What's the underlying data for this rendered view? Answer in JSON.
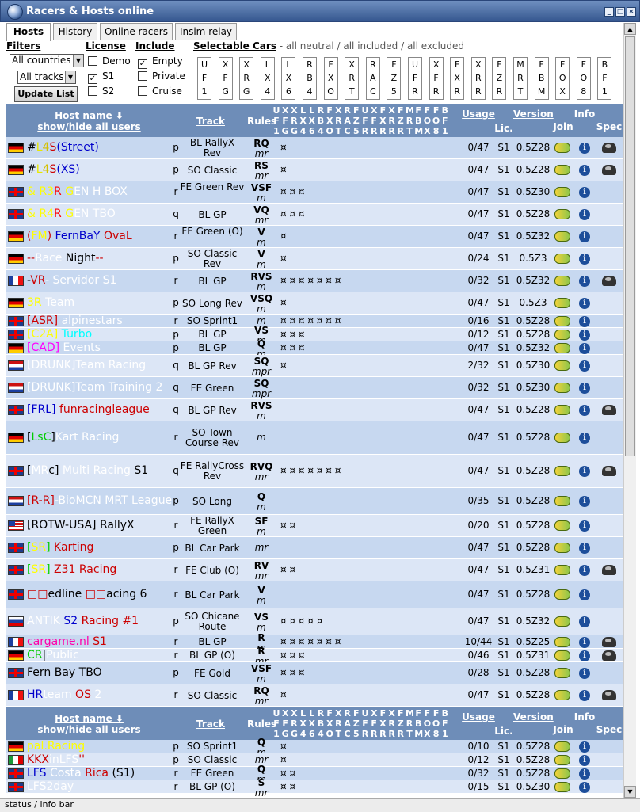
{
  "window": {
    "title": "Racers & Hosts online",
    "status": "status / info bar"
  },
  "tabs": [
    "Hosts",
    "History",
    "Online racers",
    "Insim relay"
  ],
  "filters": {
    "label": "Filters",
    "country": "All countries",
    "track": "All tracks",
    "update": "Update List",
    "license_label": "License",
    "license": [
      {
        "label": "Demo",
        "checked": false
      },
      {
        "label": "S1",
        "checked": true
      },
      {
        "label": "S2",
        "checked": false
      }
    ],
    "include_label": "Include",
    "include": [
      {
        "label": "Empty",
        "checked": true
      },
      {
        "label": "Private",
        "checked": false
      },
      {
        "label": "Cruise",
        "checked": false
      }
    ],
    "cars_label": "Selectable Cars",
    "cars_note": " - all neutral / all included / all excluded",
    "cars": [
      "UF1",
      "XFG",
      "XRG",
      "LX4",
      "LX6",
      "RB4",
      "FXO",
      "XRT",
      "RAC",
      "FZ5",
      "UFR",
      "XFR",
      "FXR",
      "XRR",
      "FZR",
      "MRT",
      "FBM",
      "FOX",
      "FO8",
      "BF1"
    ]
  },
  "header": {
    "host": "Host name ⬇",
    "showhide": "show/hide all users",
    "track": "Track",
    "rules": "Rules",
    "cars": [
      "UF1",
      "XFG",
      "XRG",
      "LX4",
      "LX6",
      "RB4",
      "FXO",
      "XRT",
      "RAC",
      "FZ5",
      "UFR",
      "XFR",
      "FXR",
      "XRR",
      "FZR",
      "MRT",
      "FBM",
      "FOX",
      "FO8",
      "BF1"
    ],
    "usage": "Usage",
    "lic": "Lic.",
    "version": "Version",
    "join": "Join",
    "info": "Info",
    "spec": "Spec"
  },
  "rows": [
    {
      "flag": "de",
      "name": [
        [
          "#",
          "#000"
        ],
        [
          "L",
          "#e8e800"
        ],
        [
          "4",
          "#d4c000"
        ],
        [
          "S",
          "#c00"
        ],
        [
          "(Street)",
          "#00c"
        ]
      ],
      "t": "p",
      "track": "BL RallyX Rev",
      "rules": "RQ mr",
      "cars": "¤",
      "usage": "0/47",
      "lic": "S1",
      "ver": "0.5Z28",
      "spec": true
    },
    {
      "flag": "de",
      "name": [
        [
          "#",
          "#000"
        ],
        [
          "L",
          "#e8e800"
        ],
        [
          "4",
          "#d4c000"
        ],
        [
          "S",
          "#c00"
        ],
        [
          "(XS)",
          "#00c"
        ]
      ],
      "t": "p",
      "track": "SO Classic",
      "rules": "RS mr",
      "cars": "¤",
      "usage": "0/47",
      "lic": "S1",
      "ver": "0.5Z28",
      "spec": true
    },
    {
      "flag": "gb",
      "name": [
        [
          "& R",
          "#ff0"
        ],
        [
          "3",
          "#ff0"
        ],
        [
          "R ",
          "#f00"
        ],
        [
          "G",
          "#ff0"
        ],
        [
          "EN H BOX",
          "#fff"
        ]
      ],
      "t": "r",
      "track": "FE Green Rev",
      "rules": "VSF m",
      "cars": "¤ ¤ ¤",
      "usage": "0/47",
      "lic": "S1",
      "ver": "0.5Z30",
      "spec": false
    },
    {
      "flag": "gb",
      "name": [
        [
          "& R",
          "#ff0"
        ],
        [
          "4",
          "#ff0"
        ],
        [
          "R ",
          "#f00"
        ],
        [
          "G",
          "#ff0"
        ],
        [
          "EN TBO",
          "#fff"
        ]
      ],
      "t": "q",
      "track": "BL GP",
      "rules": "VQ mr",
      "cars": "¤ ¤ ¤",
      "usage": "0/47",
      "lic": "S1",
      "ver": "0.5Z28",
      "spec": false
    },
    {
      "flag": "de",
      "name": [
        [
          "(",
          "#c00"
        ],
        [
          "FM",
          "#ff0"
        ],
        [
          ")",
          "#c00"
        ],
        [
          " FernBaY ",
          "#00c"
        ],
        [
          "OvaL",
          "#c00"
        ]
      ],
      "t": "r",
      "track": "FE Green (O)",
      "rules": "V m",
      "cars": "¤",
      "usage": "0/47",
      "lic": "S1",
      "ver": "0.5Z32",
      "spec": false
    },
    {
      "flag": "de",
      "name": [
        [
          "--",
          "#c00"
        ],
        [
          "Race ",
          "#fff"
        ],
        [
          "Night",
          "#000"
        ],
        [
          "--",
          "#c00"
        ]
      ],
      "t": "p",
      "track": "SO Classic Rev",
      "rules": "V m",
      "cars": "¤",
      "usage": "0/24",
      "lic": "S1",
      "ver": "0.5Z3",
      "spec": false
    },
    {
      "flag": "fr",
      "name": [
        [
          "-",
          "#000"
        ],
        [
          "VR",
          "#c00"
        ],
        [
          "- Servidor S1",
          "#fff"
        ]
      ],
      "t": "r",
      "track": "BL GP",
      "rules": "RVS m",
      "cars": "¤ ¤ ¤ ¤ ¤ ¤ ¤",
      "usage": "0/32",
      "lic": "S1",
      "ver": "0.5Z32",
      "spec": true
    },
    {
      "flag": "de",
      "name": [
        [
          "3R ",
          "#ff0"
        ],
        [
          "Team",
          "#fff"
        ]
      ],
      "t": "p",
      "track": "SO Long Rev",
      "rules": "VSQ m",
      "cars": "¤",
      "usage": "0/47",
      "lic": "S1",
      "ver": "0.5Z3",
      "spec": false
    },
    {
      "flag": "gb",
      "name": [
        [
          "[ASR]",
          "#c00"
        ],
        [
          " alpinestars",
          "#fff"
        ]
      ],
      "t": "r",
      "track": "SO Sprint1",
      "rules": "m",
      "cars": "¤ ¤ ¤ ¤ ¤ ¤ ¤",
      "usage": "0/16",
      "lic": "S1",
      "ver": "0.5Z28",
      "spec": false
    },
    {
      "flag": "gb",
      "name": [
        [
          "[C2A]",
          "#ff0"
        ],
        [
          " Turbo",
          "#0ff"
        ]
      ],
      "t": "p",
      "track": "BL GP",
      "rules": "VS m",
      "cars": "¤ ¤ ¤",
      "usage": "0/12",
      "lic": "S1",
      "ver": "0.5Z28",
      "spec": false
    },
    {
      "flag": "de",
      "name": [
        [
          "[CAD]",
          "#f0f"
        ],
        [
          " Events",
          "#fff"
        ]
      ],
      "t": "p",
      "track": "BL GP",
      "rules": "Q m",
      "cars": "¤ ¤ ¤",
      "usage": "0/47",
      "lic": "S1",
      "ver": "0.5Z32",
      "spec": false
    },
    {
      "flag": "nl",
      "name": [
        [
          "[DRUNK]Team Racing",
          "#fff"
        ]
      ],
      "t": "q",
      "track": "BL GP Rev",
      "rules": "SQ mpr",
      "cars": "¤",
      "usage": "2/32",
      "lic": "S1",
      "ver": "0.5Z30",
      "spec": false
    },
    {
      "flag": "nl",
      "name": [
        [
          "[DRUNK]Team Training 2",
          "#fff"
        ]
      ],
      "t": "q",
      "track": "FE Green",
      "rules": "SQ mpr",
      "cars": "",
      "usage": "0/32",
      "lic": "S1",
      "ver": "0.5Z30",
      "spec": false
    },
    {
      "flag": "gb",
      "name": [
        [
          "[FRL]",
          "#00c"
        ],
        [
          " funracingleague",
          "#c00"
        ]
      ],
      "t": "q",
      "track": "BL GP Rev",
      "rules": "RVS m",
      "cars": "",
      "usage": "0/47",
      "lic": "S1",
      "ver": "0.5Z28",
      "spec": true
    },
    {
      "flag": "de",
      "name": [
        [
          "[",
          "#000"
        ],
        [
          "LsC",
          "#0c0"
        ],
        [
          "]",
          "#000"
        ],
        [
          "Kart Racing",
          "#fff"
        ]
      ],
      "t": "r",
      "track": "SO Town Course Rev",
      "rules": "m",
      "cars": "",
      "usage": "0/47",
      "lic": "S1",
      "ver": "0.5Z28",
      "spec": false
    },
    {
      "flag": "gb",
      "name": [
        [
          "[",
          "#000"
        ],
        [
          "MR",
          "#fff"
        ],
        [
          "c]",
          "#000"
        ],
        [
          " Multi Racing ",
          "#fff"
        ],
        [
          "S1",
          "#000"
        ]
      ],
      "t": "q",
      "track": "FE RallyCross Rev",
      "rules": "RVQ mr",
      "cars": "¤ ¤ ¤ ¤ ¤ ¤ ¤",
      "usage": "0/47",
      "lic": "S1",
      "ver": "0.5Z28",
      "spec": true
    },
    {
      "flag": "nl",
      "name": [
        [
          "[R-R]",
          "#c00"
        ],
        [
          "-BioMCN MRT League",
          "#fff"
        ]
      ],
      "t": "p",
      "track": "SO Long",
      "rules": "Q m",
      "cars": "",
      "usage": "0/35",
      "lic": "S1",
      "ver": "0.5Z28",
      "spec": false
    },
    {
      "flag": "us",
      "name": [
        [
          "[ROTW-USA] RallyX",
          "#000"
        ]
      ],
      "t": "r",
      "track": "FE RallyX Green",
      "rules": "SF m",
      "cars": "¤ ¤",
      "usage": "0/20",
      "lic": "S1",
      "ver": "0.5Z28",
      "spec": false
    },
    {
      "flag": "gb",
      "name": [
        [
          "[",
          "#0c0"
        ],
        [
          "SR",
          "#ff0"
        ],
        [
          "]",
          "#0c0"
        ],
        [
          " Karting",
          "#c00"
        ]
      ],
      "t": "p",
      "track": "BL Car Park",
      "rules": "mr",
      "cars": "",
      "usage": "0/47",
      "lic": "S1",
      "ver": "0.5Z28",
      "spec": false
    },
    {
      "flag": "gb",
      "name": [
        [
          "[",
          "#0c0"
        ],
        [
          "SR",
          "#ff0"
        ],
        [
          "]",
          "#0c0"
        ],
        [
          " Z31 Racing",
          "#c00"
        ]
      ],
      "t": "r",
      "track": "FE Club (O)",
      "rules": "RV mr",
      "cars": "¤ ¤",
      "usage": "0/47",
      "lic": "S1",
      "ver": "0.5Z31",
      "spec": true
    },
    {
      "flag": "gb",
      "name": [
        [
          "□□",
          "#c00"
        ],
        [
          "edline ",
          "#000"
        ],
        [
          "□□",
          "#c00"
        ],
        [
          "acing 6",
          "#000"
        ]
      ],
      "t": "r",
      "track": "BL Car Park",
      "rules": "V m",
      "cars": "",
      "usage": "0/47",
      "lic": "S1",
      "ver": "0.5Z28",
      "spec": false
    },
    {
      "flag": "sk",
      "name": [
        [
          "ANTIK ",
          "#fff"
        ],
        [
          "S2 ",
          "#00c"
        ],
        [
          "Racing #1",
          "#c00"
        ]
      ],
      "t": "p",
      "track": "SO Chicane Route",
      "rules": "VS m",
      "cars": "¤ ¤ ¤ ¤ ¤",
      "usage": "0/47",
      "lic": "S1",
      "ver": "0.5Z32",
      "spec": false
    },
    {
      "flag": "fr",
      "name": [
        [
          "cargame.nl ",
          "#f0a"
        ],
        [
          "S1",
          "#c00"
        ]
      ],
      "t": "r",
      "track": "BL GP",
      "rules": "R m",
      "cars": "¤ ¤ ¤ ¤ ¤ ¤ ¤",
      "usage": "10/44",
      "lic": "S1",
      "ver": "0.5Z25",
      "spec": true
    },
    {
      "flag": "de",
      "name": [
        [
          "CR",
          "#0c0"
        ],
        [
          "|",
          "#000"
        ],
        [
          "Public",
          "#fff"
        ]
      ],
      "t": "r",
      "track": "BL GP (O)",
      "rules": "R mr",
      "cars": "¤ ¤ ¤",
      "usage": "0/46",
      "lic": "S1",
      "ver": "0.5Z31",
      "spec": true
    },
    {
      "flag": "gb",
      "name": [
        [
          "Fern Bay TBO",
          "#000"
        ]
      ],
      "t": "p",
      "track": "FE Gold",
      "rules": "VSF m",
      "cars": "¤ ¤ ¤",
      "usage": "0/28",
      "lic": "S1",
      "ver": "0.5Z28",
      "spec": false
    },
    {
      "flag": "fr",
      "name": [
        [
          "HR",
          "#00c"
        ],
        [
          "team ",
          "#fff"
        ],
        [
          "OS ",
          "#c00"
        ],
        [
          "2",
          "#fff"
        ]
      ],
      "t": "r",
      "track": "SO Classic",
      "rules": "RQ mr",
      "cars": "¤",
      "usage": "0/47",
      "lic": "S1",
      "ver": "0.5Z28",
      "spec": true
    }
  ],
  "rows2": [
    {
      "flag": "de",
      "name": [
        [
          "pal.",
          "#ff0"
        ],
        [
          "Racing",
          "#ff0"
        ]
      ],
      "t": "p",
      "track": "SO Sprint1",
      "rules": "Q m",
      "cars": "¤",
      "usage": "0/10",
      "lic": "S1",
      "ver": "0.5Z28",
      "spec": false
    },
    {
      "flag": "it",
      "name": [
        [
          "KKX",
          "#c00"
        ],
        [
          "inLFS",
          "#fff"
        ],
        [
          "''",
          "#c00"
        ]
      ],
      "t": "p",
      "track": "SO Classic",
      "rules": "mr",
      "cars": "¤",
      "usage": "0/12",
      "lic": "S1",
      "ver": "0.5Z28",
      "spec": false
    },
    {
      "flag": "gb",
      "name": [
        [
          "LFS ",
          "#00c"
        ],
        [
          "Costa ",
          "#fff"
        ],
        [
          "Rica",
          "#c00"
        ],
        [
          " (S1)",
          "#000"
        ]
      ],
      "t": "r",
      "track": "FE Green",
      "rules": "Q m",
      "cars": "¤ ¤",
      "usage": "0/32",
      "lic": "S1",
      "ver": "0.5Z28",
      "spec": false
    },
    {
      "flag": "gb",
      "name": [
        [
          "LFS2day",
          "#fff"
        ]
      ],
      "t": "r",
      "track": "BL GP (O)",
      "rules": "S mr",
      "cars": "¤ ¤",
      "usage": "0/15",
      "lic": "S1",
      "ver": "0.5Z30",
      "spec": false
    }
  ]
}
